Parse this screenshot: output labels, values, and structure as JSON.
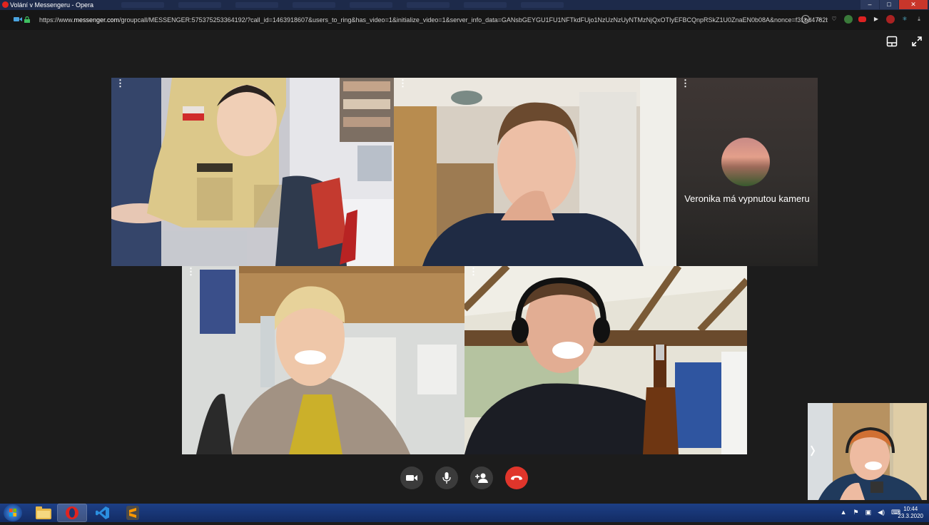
{
  "window": {
    "title": "Volání v Messengeru - Opera"
  },
  "window_controls": {
    "minimize": "–",
    "maximize": "□",
    "close": "✕"
  },
  "address_bar": {
    "url_prefix": "https://www.",
    "url_domain": "messenger.com",
    "url_rest": "/groupcall/MESSENGER:575375253364192/?call_id=1463918607&users_to_ring&has_video=1&initialize_video=1&server_info_data=GANsbGEYGU1FU1NFTkdFUjo1NzUzNzUyNTMzNjQxOTIyEFBCQnpRSkZ1U0ZnaEN0b08A&nonce=f31bd4762bc93&ext=15"
  },
  "call": {
    "participant_off_camera_label": "Veronika má vypnutou kameru",
    "more_menu_glyph": "⋮"
  },
  "taskbar": {
    "time": "10:44",
    "date": "23.3.2020"
  },
  "colors": {
    "end_call": "#e0352b",
    "control_bg": "#3b3b3b",
    "stage_bg": "#1c1c1c",
    "taskbar": "#163470"
  }
}
